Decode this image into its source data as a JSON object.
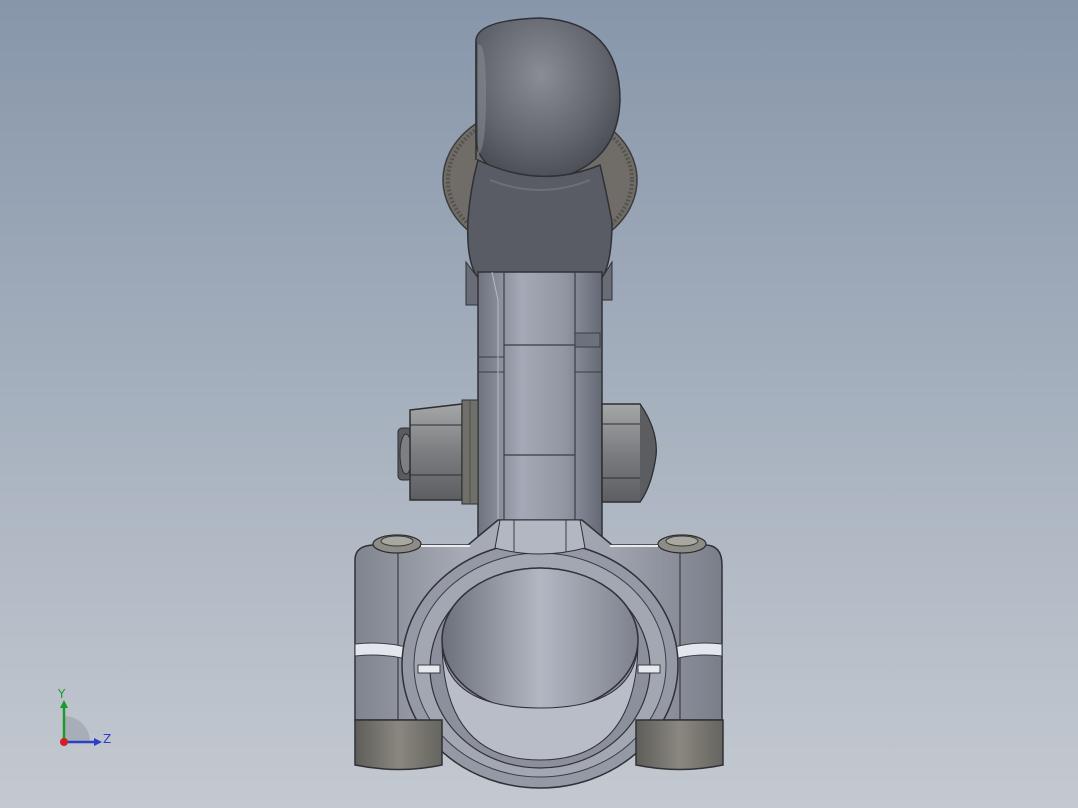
{
  "viewport": {
    "background_top": "#8796aa",
    "background_bottom": "#c4c9d0"
  },
  "model": {
    "description_icon": "handlebar-mount-clamp-icon",
    "body_color": "#9aa0ad",
    "shadow_color": "#4b4f57",
    "knob_color": "#6e7078",
    "nut_color": "#8c8d8f",
    "pad_color": "#7a7870"
  },
  "triad": {
    "y_label": "Y",
    "z_label": "Z",
    "y_color": "#1c9a2a",
    "z_color": "#2b3fc9",
    "x_color": "#d02020"
  }
}
